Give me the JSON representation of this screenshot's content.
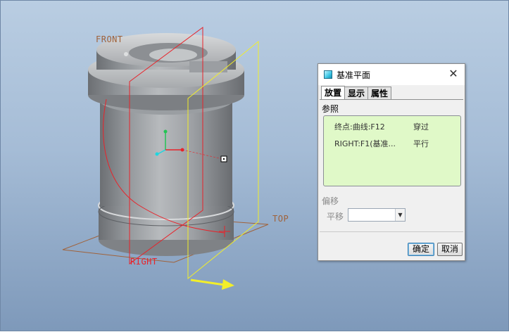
{
  "viewport": {
    "labels": {
      "front": "FRONT",
      "top": "TOP",
      "right": "RIGHT"
    },
    "colors": {
      "background_top": "#b9cde2",
      "background_bottom": "#7e99ba",
      "datum_red": "#e8232a",
      "preview_yellow": "#f2ee2a",
      "datum_brown": "#a0623a"
    }
  },
  "dialog": {
    "icon": "datum-plane-icon",
    "title": "基准平面",
    "close_icon": "close-icon",
    "tabs": [
      {
        "label": "放置",
        "active": true
      },
      {
        "label": "显示",
        "active": false
      },
      {
        "label": "属性",
        "active": false
      }
    ],
    "references_label": "参照",
    "references": [
      {
        "name": "终点:曲线:F12",
        "constraint": "穿过"
      },
      {
        "name": "RIGHT:F1(基准...",
        "constraint": "平行"
      }
    ],
    "offset_label": "偏移",
    "translation_label": "平移",
    "translation_value": "",
    "ok_label": "确定",
    "cancel_label": "取消"
  }
}
